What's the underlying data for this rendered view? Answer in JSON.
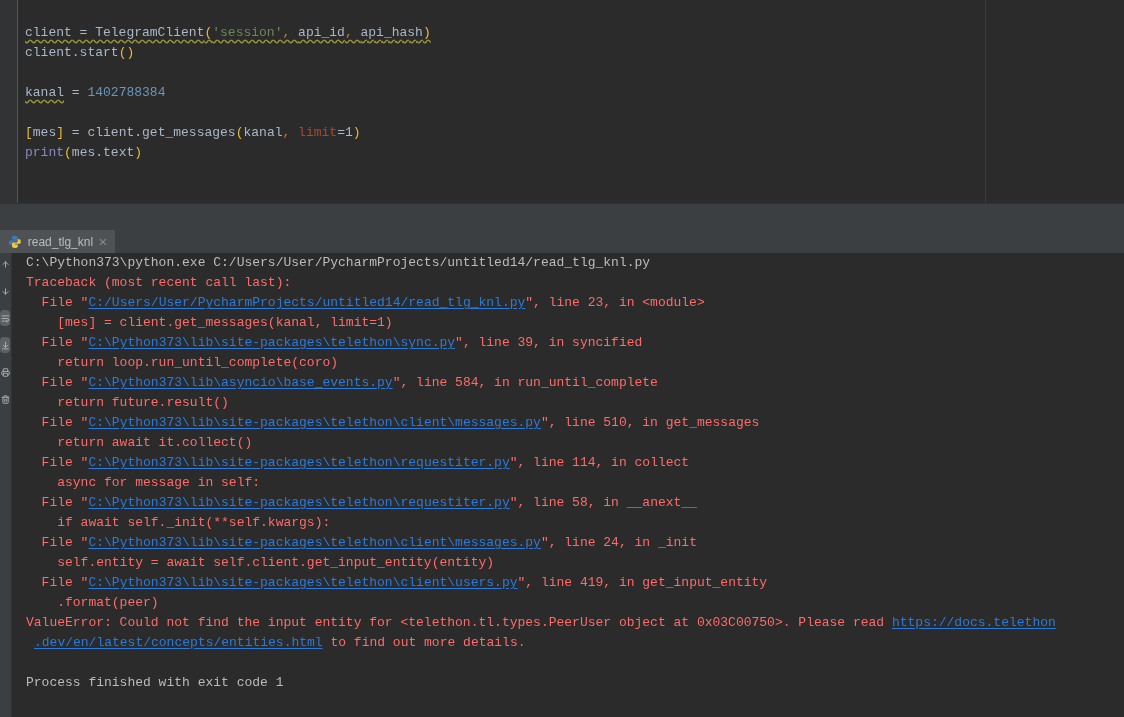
{
  "editor": {
    "blocks": [
      [
        [
          {
            "text": "client = TelegramClient",
            "kind": "plain",
            "warning": true
          },
          {
            "text": "(",
            "kind": "bracket",
            "warning": true
          },
          {
            "text": "'session'",
            "kind": "string",
            "warning": true
          },
          {
            "text": ", ",
            "kind": "comma",
            "warning": true
          },
          {
            "text": "api_id",
            "kind": "plain",
            "warning": true
          },
          {
            "text": ", ",
            "kind": "comma",
            "warning": true
          },
          {
            "text": "api_hash",
            "kind": "plain",
            "warning": true
          },
          {
            "text": ")",
            "kind": "bracket",
            "warning": true
          }
        ],
        [
          {
            "text": "client.start",
            "kind": "plain",
            "warning": false
          },
          {
            "text": "()",
            "kind": "bracket",
            "warning": false
          }
        ]
      ],
      [
        [
          {
            "text": "kanal",
            "kind": "plain",
            "warning": true
          },
          {
            "text": " = ",
            "kind": "plain",
            "warning": false
          },
          {
            "text": "1402788384",
            "kind": "number",
            "warning": false
          }
        ]
      ],
      [
        [
          {
            "text": "[",
            "kind": "bracket",
            "warning": false
          },
          {
            "text": "mes",
            "kind": "plain",
            "warning": false
          },
          {
            "text": "]",
            "kind": "bracket",
            "warning": false
          },
          {
            "text": " = client.get_messages",
            "kind": "plain",
            "warning": false
          },
          {
            "text": "(",
            "kind": "bracket",
            "warning": false
          },
          {
            "text": "kanal",
            "kind": "plain",
            "warning": false
          },
          {
            "text": ", ",
            "kind": "comma",
            "warning": false
          },
          {
            "text": "limit",
            "kind": "keyword",
            "warning": false
          },
          {
            "text": "=1",
            "kind": "plain",
            "warning": false
          },
          {
            "text": ")",
            "kind": "bracket",
            "warning": false
          }
        ],
        [
          {
            "text": "print",
            "kind": "builtin",
            "warning": false
          },
          {
            "text": "(",
            "kind": "bracket",
            "warning": false
          },
          {
            "text": "mes.text",
            "kind": "plain",
            "warning": false
          },
          {
            "text": ")",
            "kind": "bracket",
            "warning": false
          }
        ]
      ]
    ]
  },
  "run_panel": {
    "tabs": [
      {
        "label": "read_tlg_knl",
        "selected": true
      }
    ],
    "toolbar": [
      {
        "kind": "up",
        "on": false
      },
      {
        "kind": "down",
        "on": false
      },
      {
        "kind": "wrap",
        "on": true
      },
      {
        "kind": "scroll-end",
        "on": true
      },
      {
        "kind": "print",
        "on": false
      },
      {
        "kind": "delete",
        "on": false
      }
    ],
    "console": {
      "blocks": [
        [
          {
            "continuation": false,
            "segments": [
              {
                "text": "C:\\Python373\\python.exe C:/Users/User/PycharmProjects/untitled14/read_tlg_knl.py",
                "kind": "plain"
              }
            ]
          },
          {
            "continuation": false,
            "segments": [
              {
                "text": "Traceback (most recent call last):",
                "kind": "error"
              }
            ]
          },
          {
            "continuation": false,
            "segments": [
              {
                "text": "  File \"",
                "kind": "error"
              },
              {
                "text": "C:/Users/User/PycharmProjects/untitled14/read_tlg_knl.py",
                "kind": "link"
              },
              {
                "text": "\", line 23, in <module>",
                "kind": "error"
              }
            ]
          },
          {
            "continuation": false,
            "segments": [
              {
                "text": "    [mes] = client.get_messages(kanal, limit=1)",
                "kind": "error"
              }
            ]
          },
          {
            "continuation": false,
            "segments": [
              {
                "text": "  File \"",
                "kind": "error"
              },
              {
                "text": "C:\\Python373\\lib\\site-packages\\telethon\\sync.py",
                "kind": "link"
              },
              {
                "text": "\", line 39, in syncified",
                "kind": "error"
              }
            ]
          },
          {
            "continuation": false,
            "segments": [
              {
                "text": "    return loop.run_until_complete(coro)",
                "kind": "error"
              }
            ]
          },
          {
            "continuation": false,
            "segments": [
              {
                "text": "  File \"",
                "kind": "error"
              },
              {
                "text": "C:\\Python373\\lib\\asyncio\\base_events.py",
                "kind": "link"
              },
              {
                "text": "\", line 584, in run_until_complete",
                "kind": "error"
              }
            ]
          },
          {
            "continuation": false,
            "segments": [
              {
                "text": "    return future.result()",
                "kind": "error"
              }
            ]
          },
          {
            "continuation": false,
            "segments": [
              {
                "text": "  File \"",
                "kind": "error"
              },
              {
                "text": "C:\\Python373\\lib\\site-packages\\telethon\\client\\messages.py",
                "kind": "link"
              },
              {
                "text": "\", line 510, in get_messages",
                "kind": "error"
              }
            ]
          },
          {
            "continuation": false,
            "segments": [
              {
                "text": "    return await it.collect()",
                "kind": "error"
              }
            ]
          },
          {
            "continuation": false,
            "segments": [
              {
                "text": "  File \"",
                "kind": "error"
              },
              {
                "text": "C:\\Python373\\lib\\site-packages\\telethon\\requestiter.py",
                "kind": "link"
              },
              {
                "text": "\", line 114, in collect",
                "kind": "error"
              }
            ]
          },
          {
            "continuation": false,
            "segments": [
              {
                "text": "    async for message in self:",
                "kind": "error"
              }
            ]
          },
          {
            "continuation": false,
            "segments": [
              {
                "text": "  File \"",
                "kind": "error"
              },
              {
                "text": "C:\\Python373\\lib\\site-packages\\telethon\\requestiter.py",
                "kind": "link"
              },
              {
                "text": "\", line 58, in __anext__",
                "kind": "error"
              }
            ]
          },
          {
            "continuation": false,
            "segments": [
              {
                "text": "    if await self._init(**self.kwargs):",
                "kind": "error"
              }
            ]
          },
          {
            "continuation": false,
            "segments": [
              {
                "text": "  File \"",
                "kind": "error"
              },
              {
                "text": "C:\\Python373\\lib\\site-packages\\telethon\\client\\messages.py",
                "kind": "link"
              },
              {
                "text": "\", line 24, in _init",
                "kind": "error"
              }
            ]
          },
          {
            "continuation": false,
            "segments": [
              {
                "text": "    self.entity = await self.client.get_input_entity(entity)",
                "kind": "error"
              }
            ]
          },
          {
            "continuation": false,
            "segments": [
              {
                "text": "  File \"",
                "kind": "error"
              },
              {
                "text": "C:\\Python373\\lib\\site-packages\\telethon\\client\\users.py",
                "kind": "link"
              },
              {
                "text": "\", line 419, in get_input_entity",
                "kind": "error"
              }
            ]
          },
          {
            "continuation": false,
            "segments": [
              {
                "text": "    .format(peer)",
                "kind": "error"
              }
            ]
          },
          {
            "continuation": false,
            "segments": [
              {
                "text": "ValueError: Could not find the input entity for <telethon.tl.types.PeerUser object at 0x03C00750>. Please read ",
                "kind": "error"
              },
              {
                "text": "https://docs.telethon",
                "kind": "link"
              }
            ]
          },
          {
            "continuation": true,
            "segments": [
              {
                "text": ".dev/en/latest/concepts/entities.html",
                "kind": "link"
              },
              {
                "text": " to find out more details.",
                "kind": "error"
              }
            ]
          }
        ],
        [
          {
            "continuation": false,
            "segments": [
              {
                "text": "Process finished with exit code 1",
                "kind": "plain"
              }
            ]
          }
        ]
      ]
    }
  }
}
